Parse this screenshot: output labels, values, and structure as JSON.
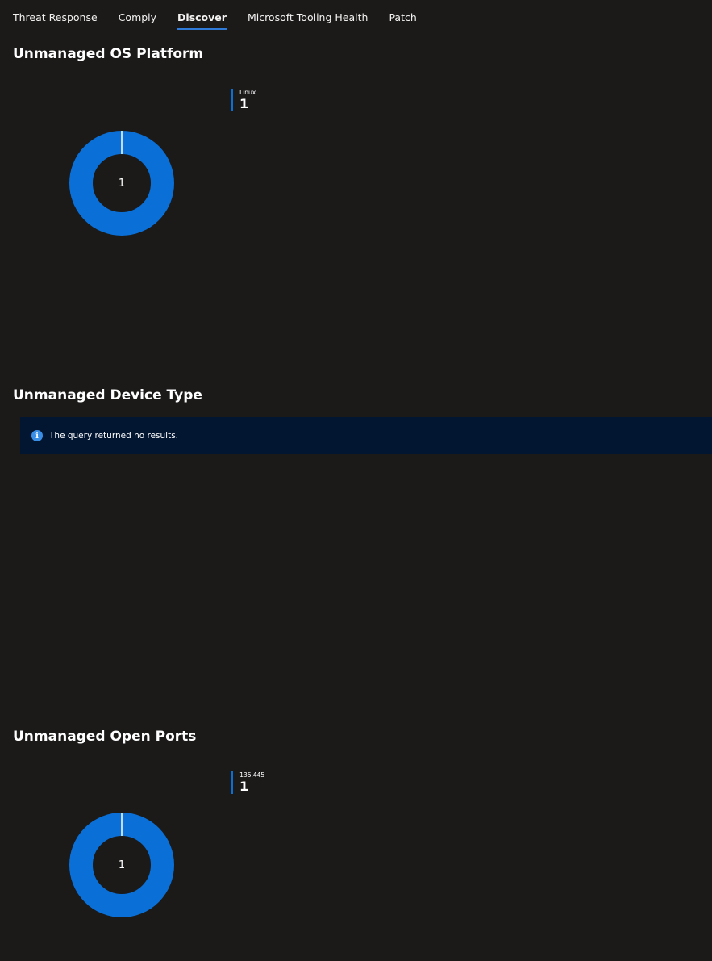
{
  "tabs": [
    {
      "label": "Threat Response"
    },
    {
      "label": "Comply"
    },
    {
      "label": "Discover",
      "active": true
    },
    {
      "label": "Microsoft Tooling Health"
    },
    {
      "label": "Patch"
    }
  ],
  "sections": {
    "os_platform": {
      "title": "Unmanaged OS Platform",
      "donut_center": "1",
      "legend": [
        {
          "label": "Linux",
          "value": "1",
          "color": "#0a6fd6"
        }
      ]
    },
    "device_type": {
      "title": "Unmanaged Device Type",
      "info_message": "The query returned no results."
    },
    "open_ports": {
      "title": "Unmanaged Open Ports",
      "donut_center": "1",
      "legend": [
        {
          "label": "135,445",
          "value": "1",
          "color": "#0a6fd6"
        }
      ]
    }
  },
  "colors": {
    "background": "#1b1a19",
    "accent": "#0a6fd6",
    "info_bar": "#021631",
    "tab_underline": "#2f7ad6"
  }
}
